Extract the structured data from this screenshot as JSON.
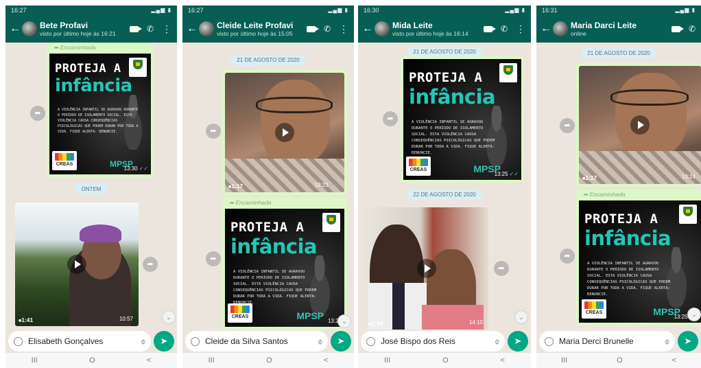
{
  "colors": {
    "header": "#075e54",
    "bubble_out": "#dcf8c6",
    "chat_bg": "#ece5dd",
    "send": "#00a884",
    "poster_accent": "#24c6b5",
    "read_check": "#53bdeb"
  },
  "poster": {
    "title_line1": "PROTEJA A",
    "title_line2": "infância",
    "body": "A VIOLÊNCIA INFANTIL SE AGRAVOU DURANTE O PERÍODO DE ISOLAMENTO SOCIAL. ESTA VIOLÊNCIA CAUSA CONSEQUÊNCIAS PSICOLÓGICAS QUE PODEM DURAR POR TODA A VIDA. FIQUE ALERTA: DENUNCIE.",
    "creas": "CREAS",
    "mpsp": "MPSP"
  },
  "forwarded_label": "Encaminhada",
  "nav": {
    "recents": "III",
    "home": "O",
    "back": "<"
  },
  "panels": [
    {
      "status_time": "16:27",
      "contact_name": "Bete Profavi",
      "contact_status": "visto por último hoje às 16:21",
      "date_divider": "ONTEM",
      "poster_time": "13:30",
      "video_duration": "1:41",
      "video_time": "10:57",
      "input_value": "Elisabeth Gonçalves"
    },
    {
      "status_time": "16:27",
      "contact_name": "Cleide Leite Profavi",
      "contact_status": "visto por último hoje às 15:05",
      "date_divider": "21 DE AGOSTO DE 2020",
      "video_duration": "1:17",
      "video_time": "13:23",
      "poster_time": "13:28",
      "input_value": "Cleide da Silva Santos"
    },
    {
      "status_time": "16:30",
      "contact_name": "Mida Leite",
      "contact_status": "visto por último hoje às 16:14",
      "date_divider": "21 DE AGOSTO DE 2020",
      "poster_time": "13:25",
      "date_divider_2": "22 DE AGOSTO DE 2020",
      "video_duration": "2:39",
      "video_time": "14:10",
      "input_value": "José Bispo dos Reis"
    },
    {
      "status_time": "16:31",
      "contact_name": "Maria Darci Leite",
      "contact_status": "online",
      "date_divider": "21 DE AGOSTO DE 2020",
      "video_duration": "1:17",
      "video_time": "13:24",
      "poster_time": "13:25",
      "input_value": "Maria Derci Brunelle"
    }
  ]
}
